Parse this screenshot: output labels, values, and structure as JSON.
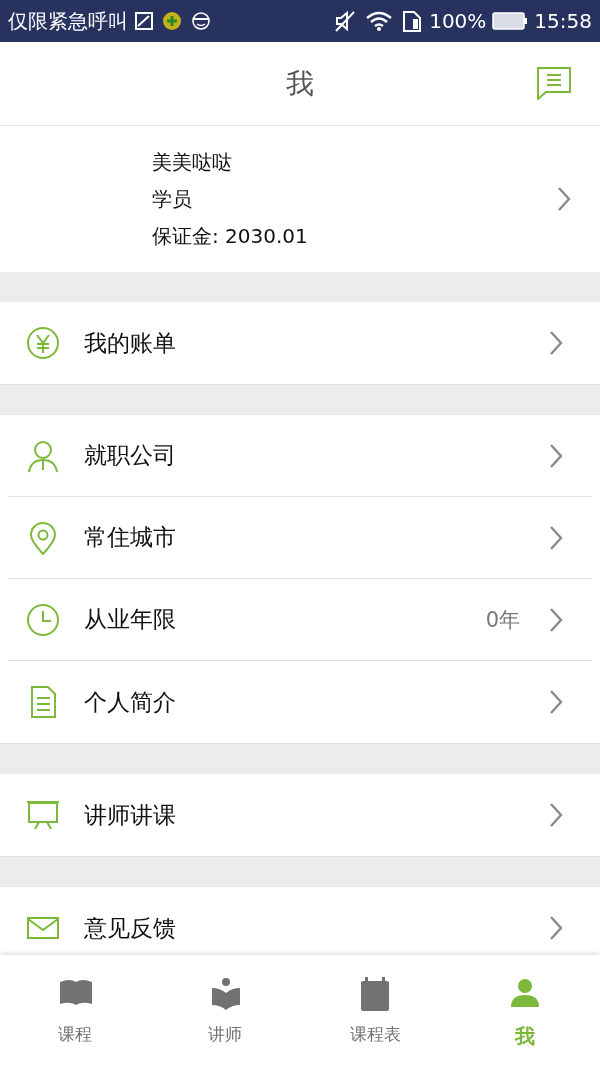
{
  "status_bar": {
    "carrier": "仅限紧急呼叫",
    "battery": "100%",
    "time": "15:58"
  },
  "header": {
    "title": "我"
  },
  "profile": {
    "name": "美美哒哒",
    "role": "学员",
    "deposit": "保证金: 2030.01"
  },
  "sections": [
    [
      {
        "label": "我的账单"
      }
    ],
    [
      {
        "label": "就职公司"
      },
      {
        "label": "常住城市"
      },
      {
        "label": "从业年限",
        "value": "0年"
      },
      {
        "label": "个人简介"
      }
    ],
    [
      {
        "label": "讲师讲课"
      }
    ],
    [
      {
        "label": "意见反馈"
      }
    ]
  ],
  "tabs": [
    {
      "label": "课程",
      "selected": false
    },
    {
      "label": "讲师",
      "selected": false
    },
    {
      "label": "课程表",
      "selected": false
    },
    {
      "label": "我",
      "selected": true
    }
  ]
}
